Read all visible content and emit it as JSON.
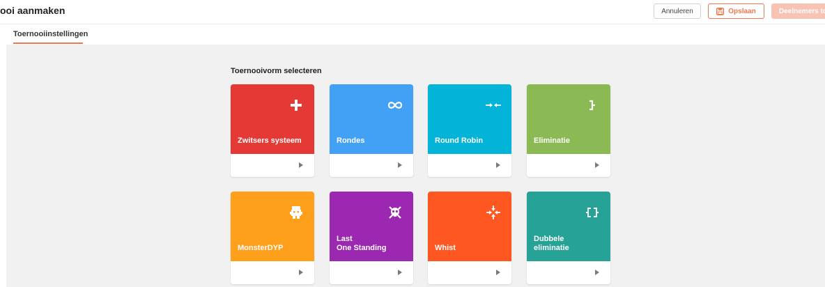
{
  "header": {
    "title": "ooi aanmaken",
    "cancel_label": "Annuleren",
    "save_label": "Opslaan",
    "participants_label": "Deelnemers toe"
  },
  "tabs": [
    {
      "label": "Toernooiinstellingen",
      "active": true
    }
  ],
  "main": {
    "section_title": "Toernooivorm selecteren",
    "cards": [
      {
        "label": "Zwitsers systeem",
        "color": "#e53935",
        "icon": "plus-icon"
      },
      {
        "label": "Rondes",
        "color": "#42a0f5",
        "icon": "infinity-icon"
      },
      {
        "label": "Round Robin",
        "color": "#03b4d8",
        "icon": "arrows-inward-icon"
      },
      {
        "label": "Eliminatie",
        "color": "#8bba55",
        "icon": "bracket-icon"
      },
      {
        "label": "MonsterDYP",
        "color": "#ffa01c",
        "icon": "monster-icon"
      },
      {
        "label": "Last\nOne Standing",
        "color": "#9c27b0",
        "icon": "skull-icon"
      },
      {
        "label": "Whist",
        "color": "#ff5722",
        "icon": "arrows-converge-icon"
      },
      {
        "label": "Dubbele\neliminatie",
        "color": "#26a296",
        "icon": "double-bracket-icon"
      }
    ]
  },
  "colors": {
    "accent": "#f07850",
    "content_bg": "#f1f1f1"
  }
}
